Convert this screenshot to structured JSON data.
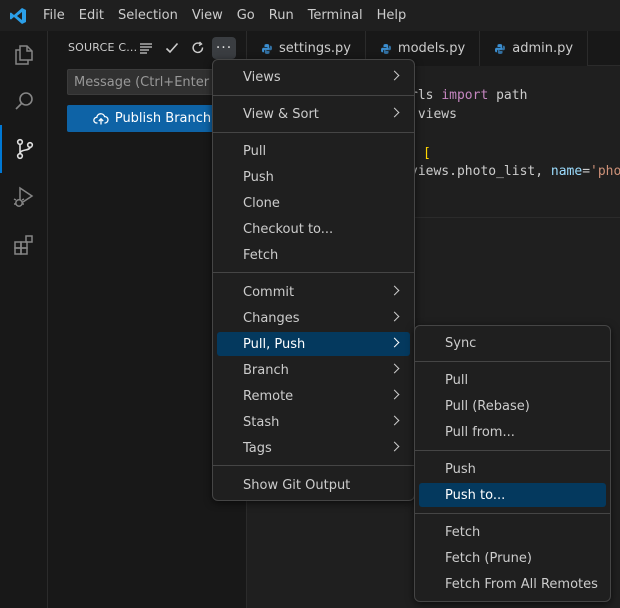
{
  "menubar": {
    "items": [
      "File",
      "Edit",
      "Selection",
      "View",
      "Go",
      "Run",
      "Terminal",
      "Help"
    ]
  },
  "activity_bar": {
    "icons": [
      "explorer-icon",
      "search-icon",
      "source-control-icon",
      "run-debug-icon",
      "extensions-icon"
    ],
    "active": "source-control-icon"
  },
  "sidebar": {
    "title": "SOURCE C...",
    "actions": [
      "view-as-tree-icon",
      "commit-check-icon",
      "refresh-icon",
      "more-actions-icon"
    ],
    "commit_placeholder": "Message (Ctrl+Enter to c",
    "publish_label": "Publish Branch"
  },
  "tabs": [
    {
      "label": "settings.py",
      "icon": "python-icon"
    },
    {
      "label": "models.py",
      "icon": "python-icon"
    },
    {
      "label": "admin.py",
      "icon": "python-icon"
    }
  ],
  "editor": {
    "line1": {
      "a": "rls ",
      "kw": "import",
      "b": " path"
    },
    "line2": " views",
    "line3": "[",
    "line4": {
      "a": "views.photo_list, ",
      "attr": "name",
      "eq": "=",
      "str": "'pho"
    }
  },
  "main_menu": {
    "items": [
      {
        "label": "Views",
        "submenu": true
      },
      {
        "label": "View & Sort",
        "submenu": true
      },
      {
        "label": "Pull"
      },
      {
        "label": "Push"
      },
      {
        "label": "Clone"
      },
      {
        "label": "Checkout to..."
      },
      {
        "label": "Fetch"
      },
      {
        "label": "Commit",
        "submenu": true
      },
      {
        "label": "Changes",
        "submenu": true
      },
      {
        "label": "Pull, Push",
        "submenu": true,
        "highlighted": true
      },
      {
        "label": "Branch",
        "submenu": true
      },
      {
        "label": "Remote",
        "submenu": true
      },
      {
        "label": "Stash",
        "submenu": true
      },
      {
        "label": "Tags",
        "submenu": true
      },
      {
        "label": "Show Git Output"
      }
    ]
  },
  "sub_menu": {
    "items": [
      {
        "label": "Sync"
      },
      {
        "label": "Pull"
      },
      {
        "label": "Pull (Rebase)"
      },
      {
        "label": "Pull from..."
      },
      {
        "label": "Push"
      },
      {
        "label": "Push to...",
        "highlighted": true
      },
      {
        "label": "Fetch"
      },
      {
        "label": "Fetch (Prune)"
      },
      {
        "label": "Fetch From All Remotes"
      }
    ]
  },
  "colors": {
    "accent": "#0078d4",
    "button": "#0e63a6",
    "menu_highlight": "#04395e",
    "python_icon": "#3b8ed0",
    "logo": "#2b9fe8"
  }
}
